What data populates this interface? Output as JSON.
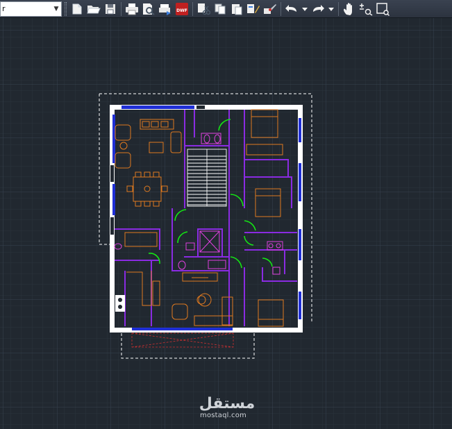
{
  "toolbar": {
    "layer_value": "r",
    "buttons": [
      {
        "name": "new-icon"
      },
      {
        "name": "open-icon"
      },
      {
        "name": "save-icon"
      },
      {
        "name": "print-icon"
      },
      {
        "name": "print-preview-icon"
      },
      {
        "name": "publish-icon"
      },
      {
        "name": "dwf-icon",
        "label": "DWF"
      },
      {
        "name": "cut-icon"
      },
      {
        "name": "copy-icon"
      },
      {
        "name": "paste-icon"
      },
      {
        "name": "match-properties-icon"
      },
      {
        "name": "undo-icon"
      },
      {
        "name": "redo-icon"
      },
      {
        "name": "pan-icon"
      },
      {
        "name": "zoom-realtime-icon"
      },
      {
        "name": "zoom-window-icon"
      }
    ]
  },
  "colors": {
    "background": "#212830",
    "grid_minor": "#2b333d",
    "grid_major": "#374150",
    "wall": "#ffffff",
    "window": "#1f2fd6",
    "partition": "#8a2be2",
    "furniture": "#e07a1f",
    "door": "#14e614",
    "fixtures": "#e040e0",
    "outline": "#ffffff",
    "hatch": "#d03030"
  },
  "watermark": {
    "logo_text": "مستقل",
    "url": "mostaql.com"
  }
}
